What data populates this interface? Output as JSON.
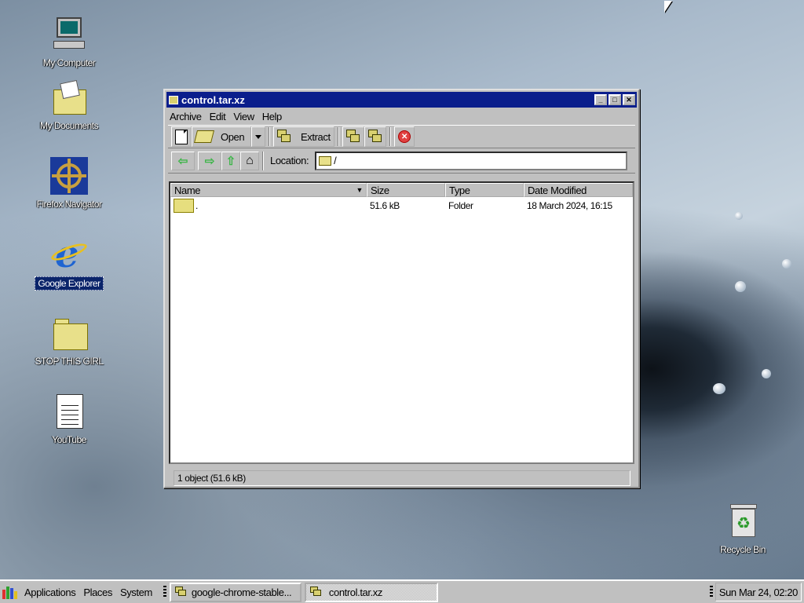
{
  "desktop": {
    "icons": [
      {
        "label": "My Computer"
      },
      {
        "label": "My Documents"
      },
      {
        "label": "Firefox Navigator"
      },
      {
        "label": "Google Explorer"
      },
      {
        "label": "STOP THIS GIRL"
      },
      {
        "label": "YouTube"
      },
      {
        "label": "Recycle Bin"
      }
    ]
  },
  "window": {
    "title": "control.tar.xz",
    "menu": [
      "Archive",
      "Edit",
      "View",
      "Help"
    ],
    "toolbar": {
      "open_label": "Open",
      "extract_label": "Extract"
    },
    "location": {
      "label": "Location:",
      "value": "/"
    },
    "columns": [
      "Name",
      "Size",
      "Type",
      "Date Modified"
    ],
    "rows": [
      {
        "name": ".",
        "size": "51.6 kB",
        "type": "Folder",
        "date": "18 March 2024, 16:15"
      }
    ],
    "status": "1 object (51.6 kB)"
  },
  "taskbar": {
    "menus": [
      "Applications",
      "Places",
      "System"
    ],
    "tasks": [
      {
        "label": "google-chrome-stable..."
      },
      {
        "label": "control.tar.xz"
      }
    ],
    "clock": "Sun Mar 24, 02:20"
  }
}
